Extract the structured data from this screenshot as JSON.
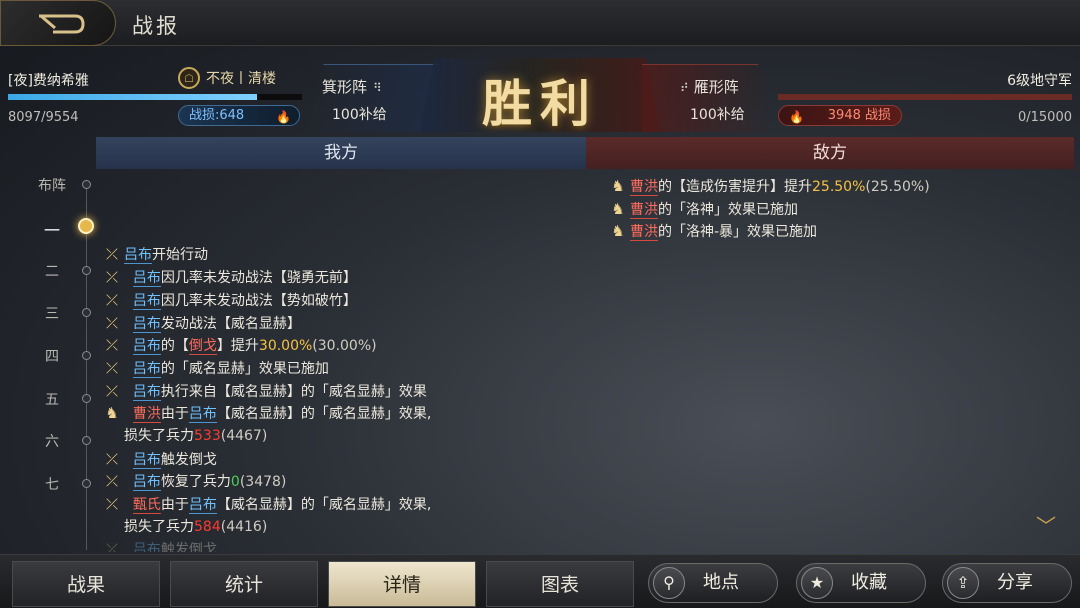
{
  "header": {
    "title": "战报"
  },
  "me": {
    "name": "[夜]费纳希雅",
    "alliance": "不夜丨清楼",
    "troops": "8097/9554",
    "troop_fraction": 0.847,
    "loss_label": "战损:648",
    "formation": "箕形阵",
    "supply": "100补给"
  },
  "result": "胜利",
  "enemy": {
    "name": "6级地守军",
    "troops": "0/15000",
    "troop_fraction": 0.0,
    "loss_label": "3948 战损",
    "formation": "雁形阵",
    "supply": "100补给"
  },
  "sides": {
    "mine": "我方",
    "enemy": "敌方"
  },
  "timeline": [
    "布阵",
    "一",
    "二",
    "三",
    "四",
    "五",
    "六",
    "七"
  ],
  "enemy_logs": [
    [
      "曹洪",
      "的【造成伤害提升】提升",
      "25.50%",
      "(25.50%)"
    ],
    [
      "曹洪",
      "的「洛神」效果已施加"
    ],
    [
      "曹洪",
      "的「洛神-暴」效果已施加"
    ]
  ],
  "my_logs": {
    "l1": [
      "吕布",
      "开始行动"
    ],
    "l2": [
      "吕布",
      "因几率未发动战法【骁勇无前】"
    ],
    "l3": [
      "吕布",
      "因几率未发动战法【势如破竹】"
    ],
    "l4": [
      "吕布",
      "发动战法【威名显赫】"
    ],
    "l5": [
      "吕布",
      "的【",
      "倒戈",
      "】提升",
      "30.00%",
      "(30.00%)"
    ],
    "l6": [
      "吕布",
      "的「威名显赫」效果已施加"
    ],
    "l7": [
      "吕布",
      "执行来自【威名显赫】的「威名显赫」效果"
    ],
    "l8": [
      "曹洪",
      "由于",
      "吕布",
      "【威名显赫】的「威名显赫」效果,"
    ],
    "l8b": [
      "损失了兵力",
      "533",
      "(4467)"
    ],
    "l9": [
      "吕布",
      "触发倒戈"
    ],
    "l10": [
      "吕布",
      "恢复了兵力",
      "0",
      "(3478)"
    ],
    "l11": [
      "甄氏",
      "由于",
      "吕布",
      "【威名显赫】的「威名显赫」效果,"
    ],
    "l11b": [
      "损失了兵力",
      "584",
      "(4416)"
    ],
    "l12": [
      "吕布",
      "触发倒戈"
    ]
  },
  "bottom_tabs": [
    "战果",
    "统计",
    "详情",
    "图表"
  ],
  "actions": [
    "地点",
    "收藏",
    "分享"
  ]
}
